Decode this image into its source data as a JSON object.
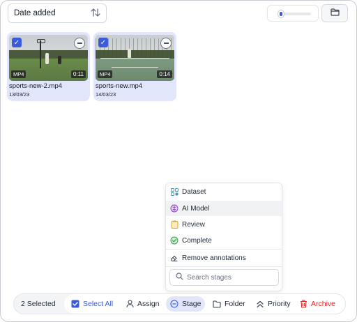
{
  "toolbar": {
    "sort_label": "Date added",
    "zoom_level": 0.15
  },
  "cards": [
    {
      "name": "sports-new-2.mp4",
      "date": "13/03/23",
      "format": "MP4",
      "duration": "0:11",
      "selected": true
    },
    {
      "name": "sports-new.mp4",
      "date": "14/03/23",
      "format": "MP4",
      "duration": "0:14",
      "selected": true
    }
  ],
  "stage_menu": {
    "items": [
      {
        "label": "Dataset",
        "icon": "dataset-icon",
        "color": "#4a9bb0"
      },
      {
        "label": "AI Model",
        "icon": "ai-model-icon",
        "color": "#8b3fc7"
      },
      {
        "label": "Review",
        "icon": "review-icon",
        "color": "#d9a521"
      },
      {
        "label": "Complete",
        "icon": "complete-icon",
        "color": "#2f9e44"
      }
    ],
    "remove_label": "Remove annotations",
    "search_placeholder": "Search stages"
  },
  "action_bar": {
    "selected_count": "2 Selected",
    "select_all": "Select All",
    "assign": "Assign",
    "stage": "Stage",
    "folder": "Folder",
    "priority": "Priority",
    "archive": "Archive",
    "accent_color": "#3b5bdb",
    "danger_color": "#dc2626"
  }
}
